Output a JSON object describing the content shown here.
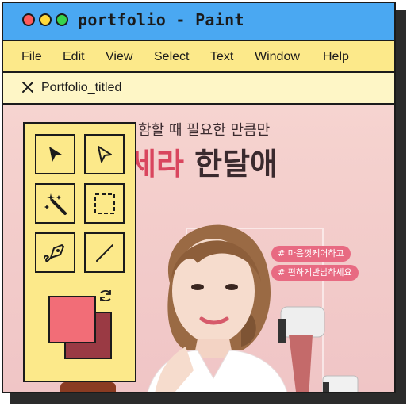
{
  "window": {
    "title": "portfolio - Paint"
  },
  "menu": [
    "File",
    "Edit",
    "View",
    "Select",
    "Text",
    "Window",
    "Help"
  ],
  "tab": {
    "label": "Portfolio_titled"
  },
  "canvas": {
    "headline_line1": "함할 때 필요한 만큼만",
    "headline_line2_pink": "세라",
    "headline_line2_dark": "한달애",
    "tags": [
      "# 마음껏케어하고",
      "# 편하게반납하세요"
    ]
  },
  "toolbox": {
    "tools": [
      "select-arrow-icon",
      "direct-select-arrow-icon",
      "magic-wand-icon",
      "marquee-select-icon",
      "pen-tool-icon",
      "line-tool-icon"
    ],
    "foreground_color": "#f26d77",
    "background_color": "#9a3a44"
  },
  "colors": {
    "titlebar": "#4aa8f2",
    "menubar": "#fce98a",
    "tabbar": "#fef6c6"
  }
}
